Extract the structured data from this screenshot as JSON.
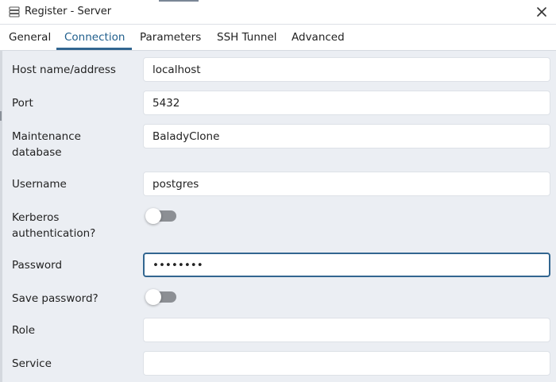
{
  "window": {
    "title": "Register - Server",
    "title_icon": "server-icon",
    "close_icon": "close-icon"
  },
  "tabs": [
    {
      "label": "General",
      "active": false
    },
    {
      "label": "Connection",
      "active": true
    },
    {
      "label": "Parameters",
      "active": false
    },
    {
      "label": "SSH Tunnel",
      "active": false
    },
    {
      "label": "Advanced",
      "active": false
    }
  ],
  "form": {
    "host": {
      "label": "Host name/address",
      "value": "localhost"
    },
    "port": {
      "label": "Port",
      "value": "5432"
    },
    "maintenance_db": {
      "label_line1": "Maintenance",
      "label_line2": "database",
      "value": "BaladyClone"
    },
    "username": {
      "label": "Username",
      "value": "postgres"
    },
    "kerberos": {
      "label_line1": "Kerberos",
      "label_line2": "authentication?",
      "enabled": false
    },
    "password": {
      "label": "Password",
      "value": "••••••••",
      "focused": true
    },
    "save_password": {
      "label": "Save password?",
      "enabled": false
    },
    "role": {
      "label": "Role",
      "value": ""
    },
    "service": {
      "label": "Service",
      "value": ""
    }
  },
  "colors": {
    "accent": "#326690",
    "background": "#ebeef3",
    "toggle_off": "#8c8f94"
  }
}
